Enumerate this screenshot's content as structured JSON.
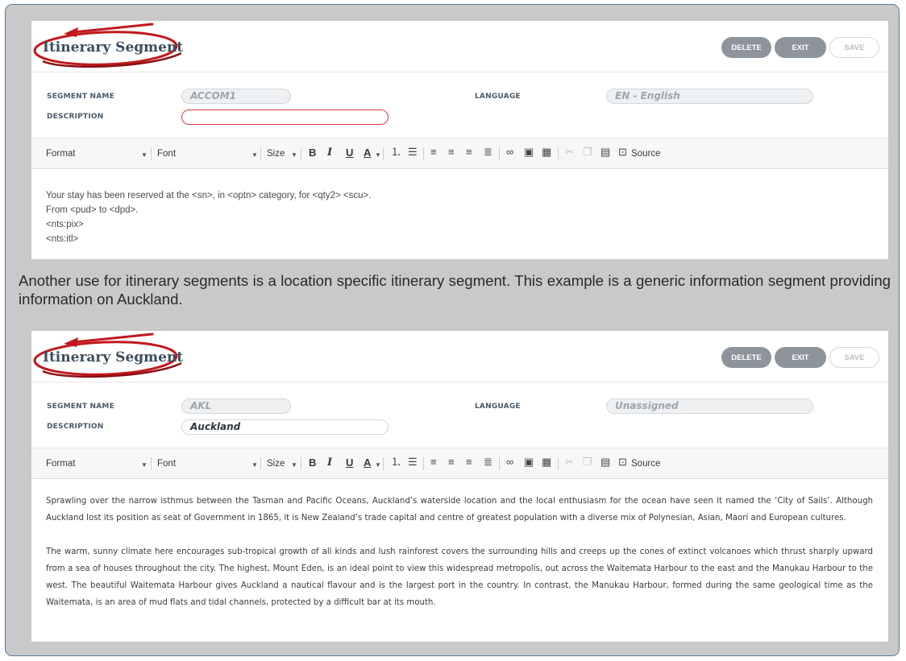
{
  "panels": [
    {
      "title": "Itinerary Segment",
      "buttons": {
        "delete": "DELETE",
        "exit": "EXIT",
        "save": "SAVE"
      },
      "fields": {
        "segment_name_label": "SEGMENT NAME",
        "segment_name_value": "ACCOM1",
        "description_label": "DESCRIPTION",
        "description_value": "",
        "language_label": "LANGUAGE",
        "language_value": "EN - English"
      },
      "content": [
        "Your stay has been reserved at the <sn>, in <optn> category, for <qty2> <scu>.",
        "From <pud> to <dpd>.",
        "<nts:pix>",
        "<nts:itl>"
      ]
    },
    {
      "title": "Itinerary Segment",
      "buttons": {
        "delete": "DELETE",
        "exit": "EXIT",
        "save": "SAVE"
      },
      "fields": {
        "segment_name_label": "SEGMENT NAME",
        "segment_name_value": "AKL",
        "description_label": "DESCRIPTION",
        "description_value": "Auckland",
        "language_label": "LANGUAGE",
        "language_value": "Unassigned"
      },
      "content": [
        "Sprawling over the narrow isthmus between the Tasman and Pacific Oceans, Auckland’s waterside location and the local enthusiasm for the ocean have seen it named the ‘City of Sails’. Although Auckland lost its position as seat of Government in 1865, it is New Zealand’s trade capital and centre of greatest population with a diverse mix of Polynesian, Asian, Maori and European cultures.",
        "The warm, sunny climate here encourages sub-tropical growth of all kinds and lush rainforest covers the surrounding hills and creeps up the cones of extinct volcanoes which thrust sharply upward from a sea of houses throughout the city. The highest, Mount Eden, is an ideal point to view this widespread metropolis, out across the Waitemata Harbour to the east and the Manukau Harbour to the west. The beautiful Waitemata Harbour gives Auckland a nautical flavour and is the largest port in the country. In contrast, the Manukau Harbour, formed during the same geological time as the Waitemata, is an area of mud flats and tidal channels, protected by a difficult bar at its mouth."
      ]
    }
  ],
  "toolbar": {
    "format": "Format",
    "font": "Font",
    "size": "Size",
    "bold": "B",
    "italic": "I",
    "underline": "U",
    "text_color": "A",
    "source": "Source",
    "icons": [
      "numbered-list-icon",
      "bullet-list-icon",
      "align-left-icon",
      "align-center-icon",
      "align-right-icon",
      "justify-icon",
      "link-icon",
      "image-icon",
      "table-icon",
      "cut-icon",
      "copy-icon",
      "paste-icon",
      "source-icon"
    ]
  },
  "caption": "Another use for itinerary segments is a location specific itinerary segment. This example is a generic information segment providing information on Auckland.",
  "colors": {
    "annotation_red": "#c0181c",
    "button_gray": "#8d949b",
    "frame_border": "#5a7d9c",
    "frame_bg": "#c9c9c9"
  }
}
